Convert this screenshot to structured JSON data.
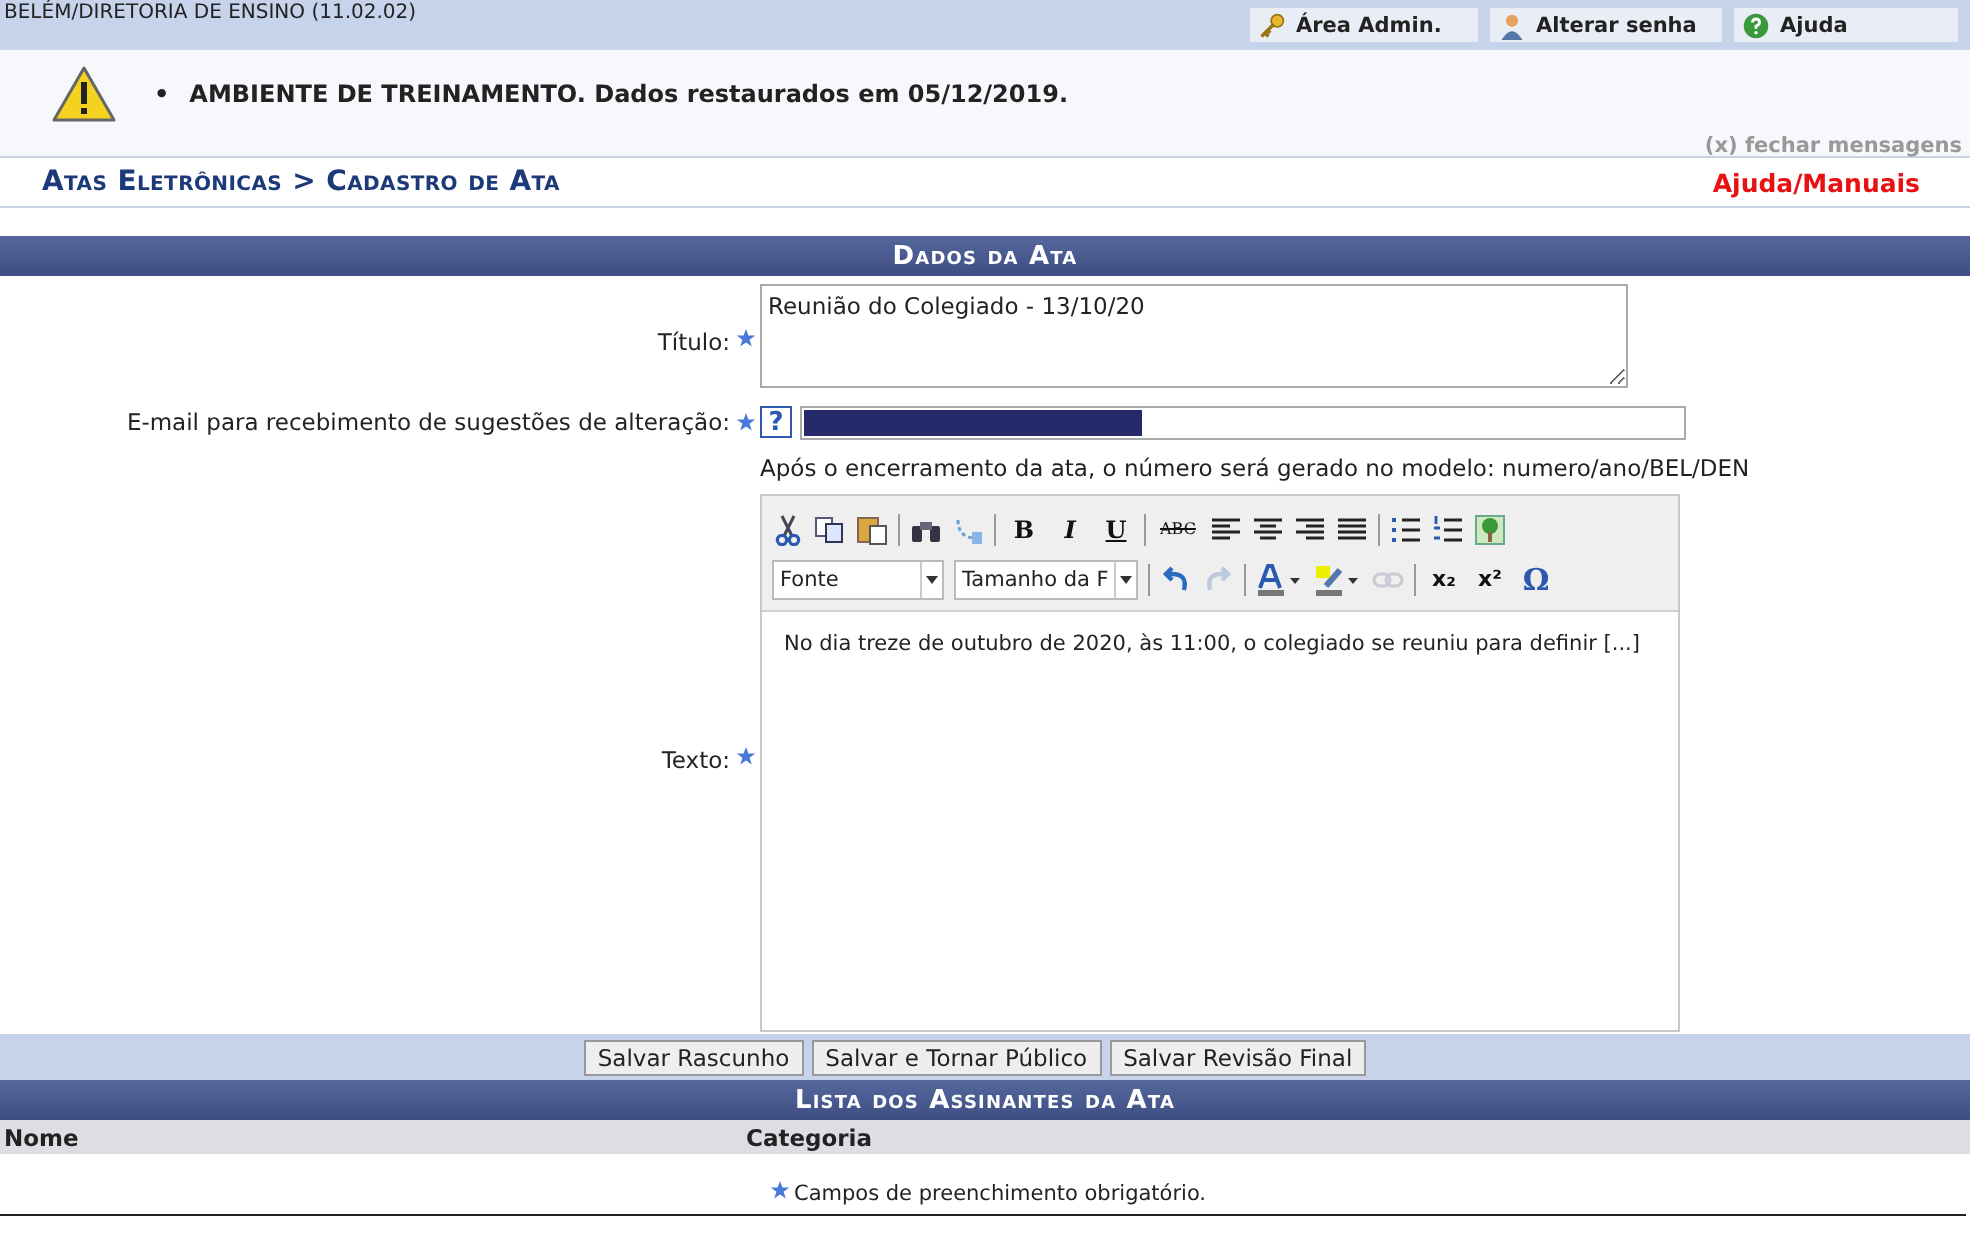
{
  "top_bar": {
    "unit": "BELÉM/DIRETORIA DE ENSINO (11.02.02)",
    "links": [
      {
        "label": "Área Admin.",
        "kind": "key"
      },
      {
        "label": "Alterar senha",
        "kind": "user"
      },
      {
        "label": "Ajuda",
        "kind": "help"
      }
    ]
  },
  "messages": {
    "items": [
      {
        "bullet": "•",
        "text": "AMBIENTE DE TREINAMENTO. Dados restaurados em 05/12/2019."
      }
    ],
    "close": "(x) fechar mensagens"
  },
  "breadcrumb": {
    "path": "Atas Eletrônicas > Cadastro de Ata",
    "help": "Ajuda/Manuais"
  },
  "form": {
    "title": "Dados da Ata",
    "titulo": {
      "label": "Título:",
      "value": "Reunião do Colegiado - 13/10/20"
    },
    "email": {
      "label": "E-mail para recebimento de sugestões de alteração:",
      "help": "?",
      "note": "Após o encerramento da ata, o número será gerado no modelo: numero/ano/BEL/DEN"
    },
    "texto": {
      "label": "Texto:",
      "value": "No dia treze de outubro de 2020, às 11:00, o colegiado se reuniu para definir [...]"
    },
    "editor": {
      "bold": "B",
      "italic": "I",
      "underline": "U",
      "spell": "ABC",
      "font": "Fonte",
      "size": "Tamanho da F",
      "subscript": "x₂",
      "superscript": "x²",
      "special": "Ω"
    },
    "buttons": [
      "Salvar Rascunho",
      "Salvar e Tornar Público",
      "Salvar Revisão Final"
    ]
  },
  "signers": {
    "title": "Lista dos Assinantes da Ata",
    "columns": [
      "Nome",
      "Categoria"
    ]
  },
  "footer": {
    "note": "Campos de preenchimento obrigatório."
  }
}
